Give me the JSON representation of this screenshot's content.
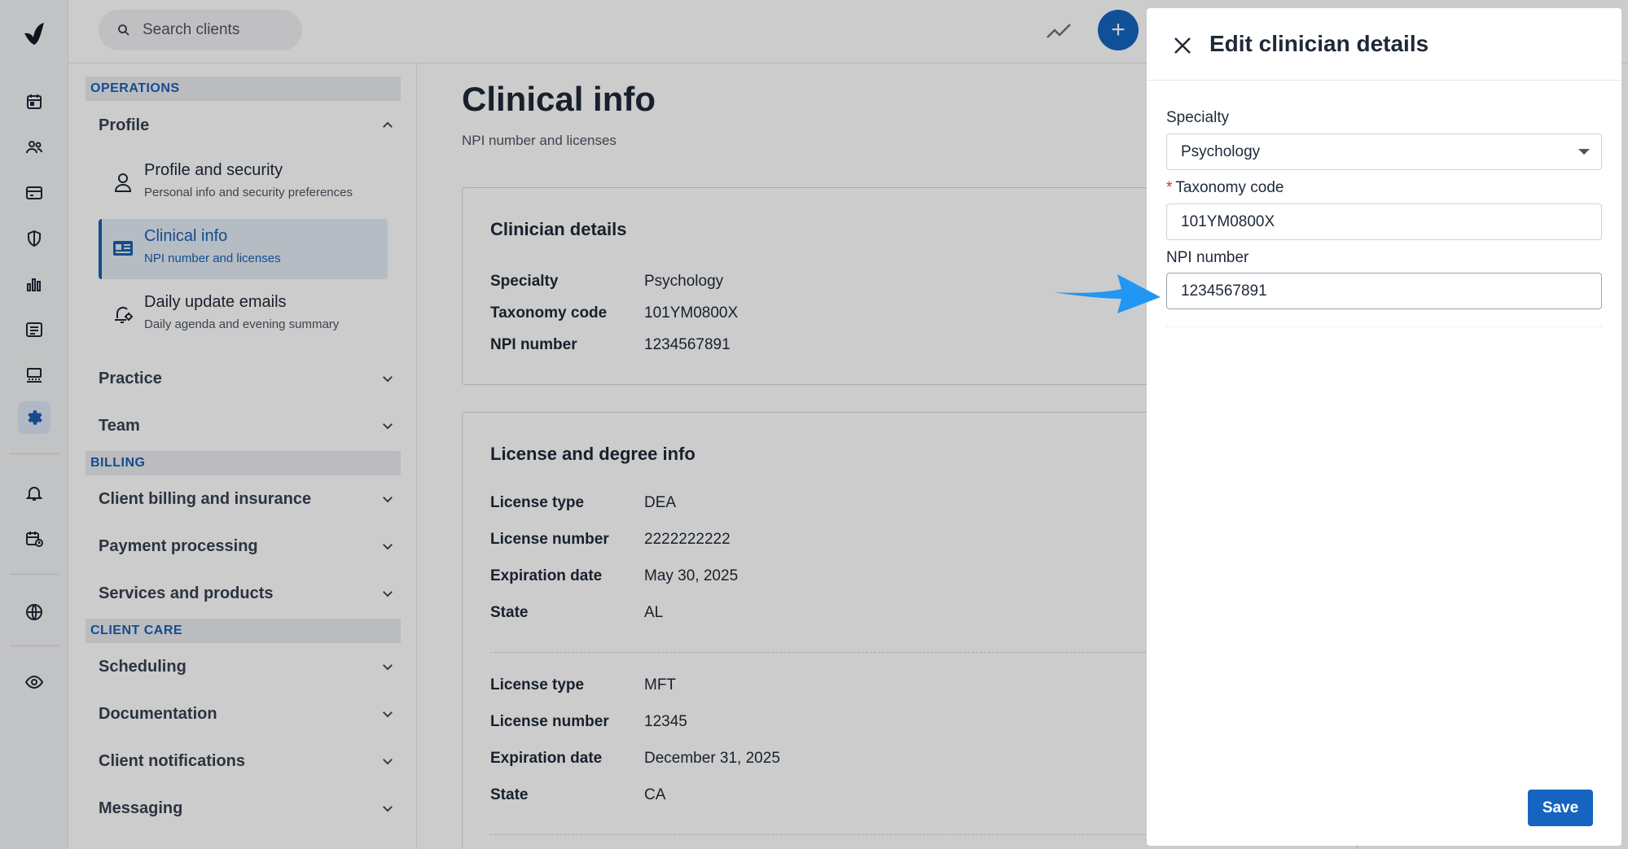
{
  "topbar": {
    "search_placeholder": "Search clients"
  },
  "rail": {
    "icons": [
      "calendar-icon",
      "clients-icon",
      "billing-card-icon",
      "shield-icon",
      "analytics-icon",
      "list-icon",
      "marketplace-icon",
      "settings-gear-icon",
      "bell-icon",
      "calendar-clock-icon",
      "globe-icon",
      "eye-icon"
    ],
    "active": "settings-gear-icon"
  },
  "settings_nav": {
    "operations_header": "OPERATIONS",
    "profile_label": "Profile",
    "profile_items": [
      {
        "title": "Profile and security",
        "desc": "Personal info and security preferences"
      },
      {
        "title": "Clinical info",
        "desc": "NPI number and licenses"
      },
      {
        "title": "Daily update emails",
        "desc": "Daily agenda and evening summary"
      }
    ],
    "practice_label": "Practice",
    "team_label": "Team",
    "billing_header": "BILLING",
    "billing_items": [
      "Client billing and insurance",
      "Payment processing",
      "Services and products"
    ],
    "client_care_header": "CLIENT CARE",
    "client_care_items": [
      "Scheduling",
      "Documentation",
      "Client notifications",
      "Messaging"
    ]
  },
  "main": {
    "title": "Clinical info",
    "subtitle": "NPI number and licenses",
    "clinician_card": {
      "title": "Clinician details",
      "rows": [
        {
          "label": "Specialty",
          "value": "Psychology"
        },
        {
          "label": "Taxonomy code",
          "value": "101YM0800X"
        },
        {
          "label": "NPI number",
          "value": "1234567891"
        }
      ]
    },
    "license_card": {
      "title": "License and degree info",
      "licenses": [
        [
          {
            "label": "License type",
            "value": "DEA"
          },
          {
            "label": "License number",
            "value": "2222222222"
          },
          {
            "label": "Expiration date",
            "value": "May 30, 2025"
          },
          {
            "label": "State",
            "value": "AL"
          }
        ],
        [
          {
            "label": "License type",
            "value": "MFT"
          },
          {
            "label": "License number",
            "value": "12345"
          },
          {
            "label": "Expiration date",
            "value": "December 31, 2025"
          },
          {
            "label": "State",
            "value": "CA"
          }
        ]
      ]
    }
  },
  "drawer": {
    "title": "Edit clinician details",
    "specialty_label": "Specialty",
    "specialty_value": "Psychology",
    "taxonomy_required_mark": "*",
    "taxonomy_label": "Taxonomy code",
    "taxonomy_value": "101YM0800X",
    "npi_label": "NPI number",
    "npi_value": "1234567891",
    "save_label": "Save"
  },
  "colors": {
    "accent": "#1565c0",
    "nav_accent": "#1c5fb0",
    "annotation_arrow": "#2196f3",
    "required": "#dc2626"
  }
}
